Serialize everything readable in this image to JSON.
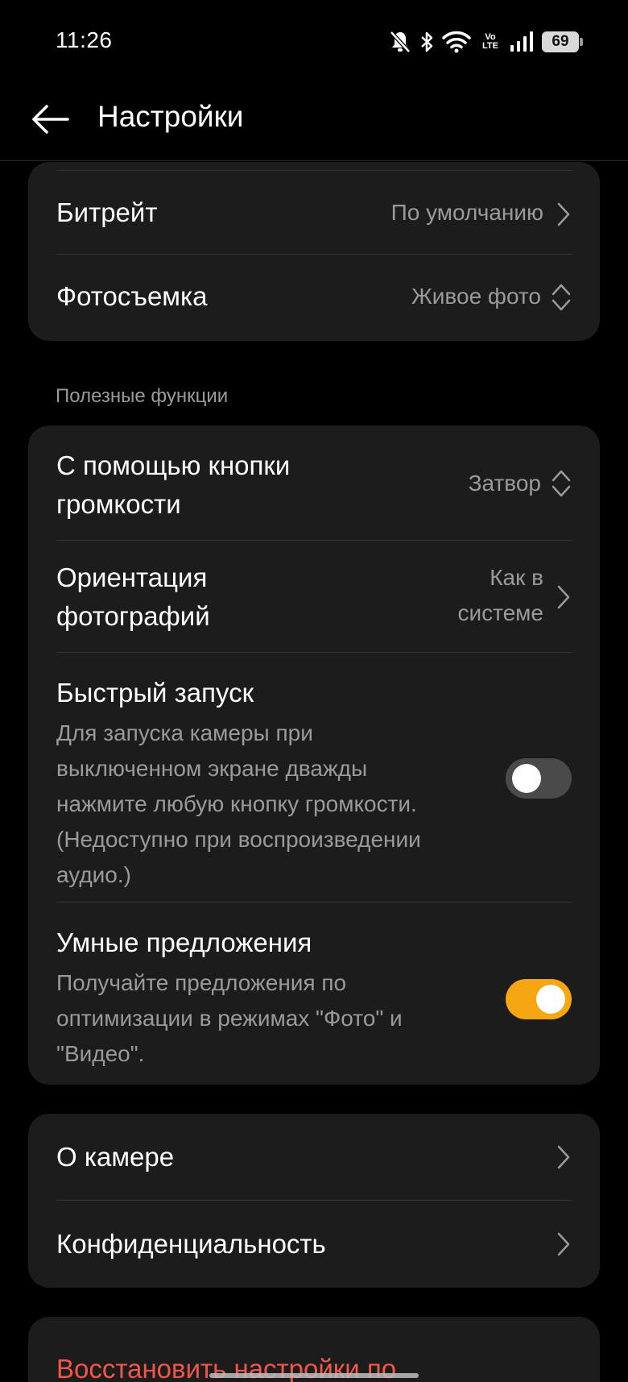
{
  "status_bar": {
    "time": "11:26",
    "volte_top": "Vo",
    "volte_bottom": "LTE",
    "battery_level": "69",
    "icons": [
      "mute-icon",
      "bluetooth-icon",
      "wifi-icon",
      "volte-icon",
      "signal-icon",
      "battery-icon"
    ]
  },
  "header": {
    "title": "Настройки",
    "back_icon": "arrow-left-icon"
  },
  "card_video": {
    "rows": [
      {
        "label": "Битрейт",
        "value": "По умолчанию",
        "icon": "chevron-right-icon"
      },
      {
        "label": "Фотосъемка",
        "value": "Живое фото",
        "icon": "up-down-chevron-icon"
      }
    ]
  },
  "section_useful": {
    "label": "Полезные функции",
    "volume_button": {
      "label_line1": "С помощью кнопки",
      "label_line2": "громкости",
      "value": "Затвор",
      "icon": "up-down-chevron-icon"
    },
    "orientation": {
      "label_line1": "Ориентация",
      "label_line2": "фотографий",
      "value_line1": "Как в",
      "value_line2": "системе",
      "icon": "chevron-right-icon"
    },
    "quick_launch": {
      "title": "Быстрый запуск",
      "desc_lines": [
        "Для запуска камеры при",
        "выключенном экране дважды",
        "нажмите любую кнопку громкости.",
        "(Недоступно при воспроизведении",
        "аудио.)"
      ],
      "enabled": false
    },
    "smart_suggestions": {
      "title": "Умные предложения",
      "desc_lines": [
        "Получайте предложения по",
        "оптимизации в режимах \"Фото\" и",
        "\"Видео\"."
      ],
      "enabled": true
    }
  },
  "card_about": {
    "rows": [
      {
        "label": "О камере",
        "icon": "chevron-right-icon"
      },
      {
        "label": "Конфиденциальность",
        "icon": "chevron-right-icon"
      }
    ]
  },
  "reset": {
    "label": "Восстановить настройки по"
  },
  "colors": {
    "background": "#000000",
    "card": "#1c1c1c",
    "accent": "#f6a611",
    "danger": "#f0574a",
    "secondary_text": "#9a9a9a"
  }
}
